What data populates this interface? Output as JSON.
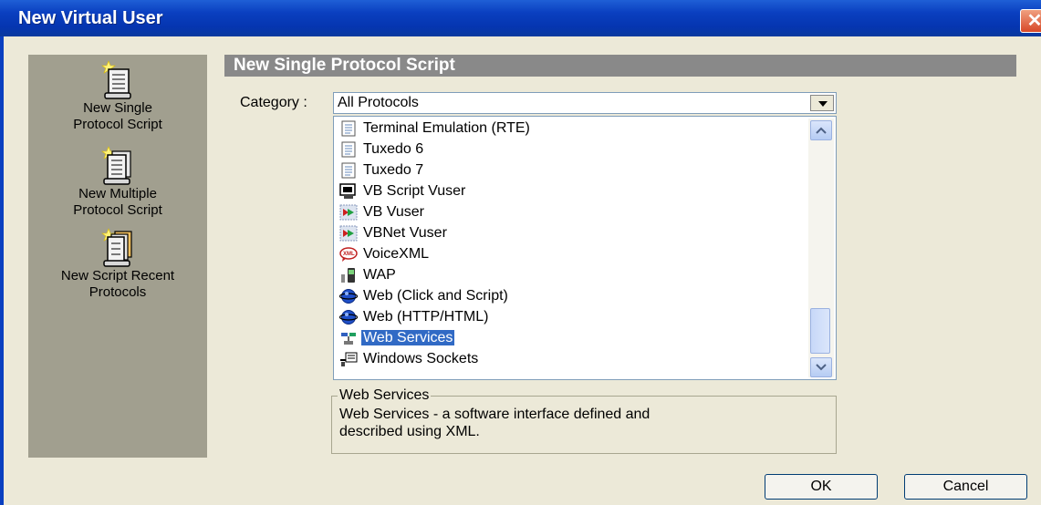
{
  "window": {
    "title": "New Virtual User"
  },
  "sidebar": {
    "items": [
      {
        "label_line1": "New Single",
        "label_line2": "Protocol Script",
        "icon": "script-new-icon"
      },
      {
        "label_line1": "New Multiple",
        "label_line2": "Protocol Script",
        "icon": "multi-script-icon"
      },
      {
        "label_line1": "New Script Recent",
        "label_line2": "Protocols",
        "icon": "recent-script-icon"
      }
    ]
  },
  "main": {
    "header": "New Single Protocol Script",
    "category_label": "Category :",
    "category_value": "All Protocols",
    "protocols": [
      {
        "label": "Terminal Emulation (RTE)",
        "icon": "document-icon"
      },
      {
        "label": "Tuxedo 6",
        "icon": "document-icon"
      },
      {
        "label": "Tuxedo 7",
        "icon": "document-icon"
      },
      {
        "label": "VB Script Vuser",
        "icon": "vb-script-icon"
      },
      {
        "label": "VB Vuser",
        "icon": "vb-icon"
      },
      {
        "label": "VBNet Vuser",
        "icon": "vbnet-icon"
      },
      {
        "label": "VoiceXML",
        "icon": "xml-bubble-icon"
      },
      {
        "label": "WAP",
        "icon": "mobile-phone-icon"
      },
      {
        "label": "Web (Click and Script)",
        "icon": "globe-icon"
      },
      {
        "label": "Web (HTTP/HTML)",
        "icon": "globe-icon"
      },
      {
        "label": "Web Services",
        "icon": "web-services-icon",
        "selected": true
      },
      {
        "label": "Windows Sockets",
        "icon": "socket-icon"
      }
    ],
    "description_title": "Web Services",
    "description_line1": "Web Services - a software interface defined and",
    "description_line2": "described using XML."
  },
  "buttons": {
    "ok": "OK",
    "cancel": "Cancel"
  },
  "colors": {
    "title_bar": "#0a3fc0",
    "sidebar": "#a19f8f",
    "header_bar": "#898989",
    "selection": "#316ac5"
  }
}
